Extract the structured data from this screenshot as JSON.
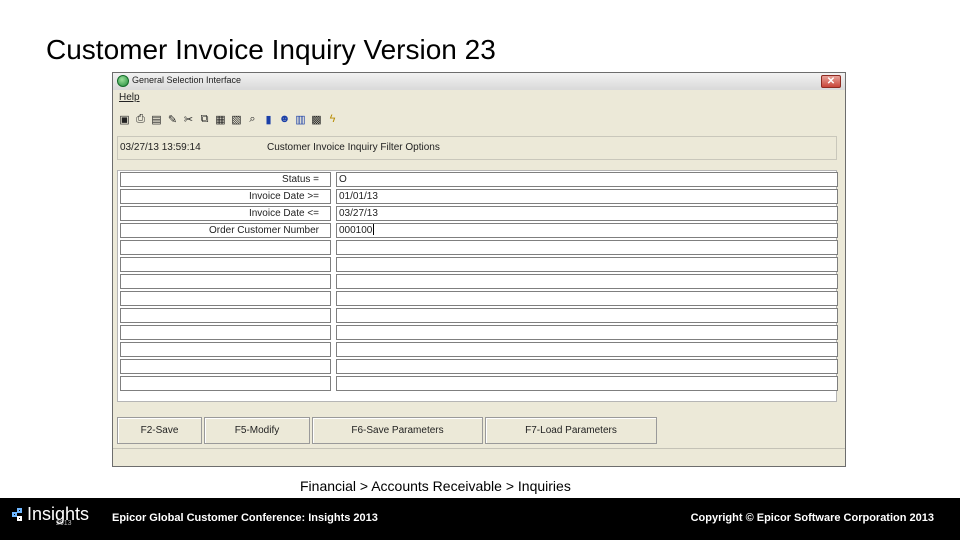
{
  "slide": {
    "title": "Customer Invoice Inquiry Version 23"
  },
  "window": {
    "title": "General Selection Interface",
    "close_glyph": "✕",
    "menu": {
      "help": "Help"
    },
    "toolbar": [
      {
        "name": "save-icon",
        "glyph": "▣"
      },
      {
        "name": "print-icon",
        "glyph": "⎙"
      },
      {
        "name": "print-preview-icon",
        "glyph": "▤"
      },
      {
        "name": "tools-icon",
        "glyph": "✎"
      },
      {
        "name": "cut-icon",
        "glyph": "✂"
      },
      {
        "name": "copy-icon",
        "glyph": "⧉"
      },
      {
        "name": "paste-icon",
        "glyph": "▦"
      },
      {
        "name": "clipboard-icon",
        "glyph": "▧"
      },
      {
        "name": "find-icon",
        "glyph": "⌕"
      },
      {
        "name": "book-icon",
        "glyph": "▮"
      },
      {
        "name": "users-icon",
        "glyph": "☻"
      },
      {
        "name": "calculator-icon",
        "glyph": "▥"
      },
      {
        "name": "grid-icon",
        "glyph": "▩"
      },
      {
        "name": "wizard-icon",
        "glyph": "ϟ"
      }
    ],
    "timestamp": "03/27/13 13:59:14",
    "filter_title": "Customer Invoice Inquiry Filter Options",
    "rows": [
      {
        "label": "Status =",
        "value": "O"
      },
      {
        "label": "Invoice Date >=",
        "value": "01/01/13"
      },
      {
        "label": "Invoice Date <=",
        "value": "03/27/13"
      },
      {
        "label": "Order Customer Number",
        "value": "000100"
      },
      {
        "label": "",
        "value": ""
      },
      {
        "label": "",
        "value": ""
      },
      {
        "label": "",
        "value": ""
      },
      {
        "label": "",
        "value": ""
      },
      {
        "label": "",
        "value": ""
      },
      {
        "label": "",
        "value": ""
      },
      {
        "label": "",
        "value": ""
      },
      {
        "label": "",
        "value": ""
      },
      {
        "label": "",
        "value": ""
      }
    ],
    "buttons": {
      "save": "F2-Save",
      "modify": "F5-Modify",
      "save_params": "F6-Save Parameters",
      "load_params": "F7-Load Parameters"
    }
  },
  "caption": "Financial > Accounts Receivable > Inquiries",
  "footer": {
    "logo_text": "Insights",
    "logo_year": "2013",
    "left": "Epicor Global Customer Conference: Insights 2013",
    "right": "Copyright © Epicor Software Corporation 2013"
  }
}
